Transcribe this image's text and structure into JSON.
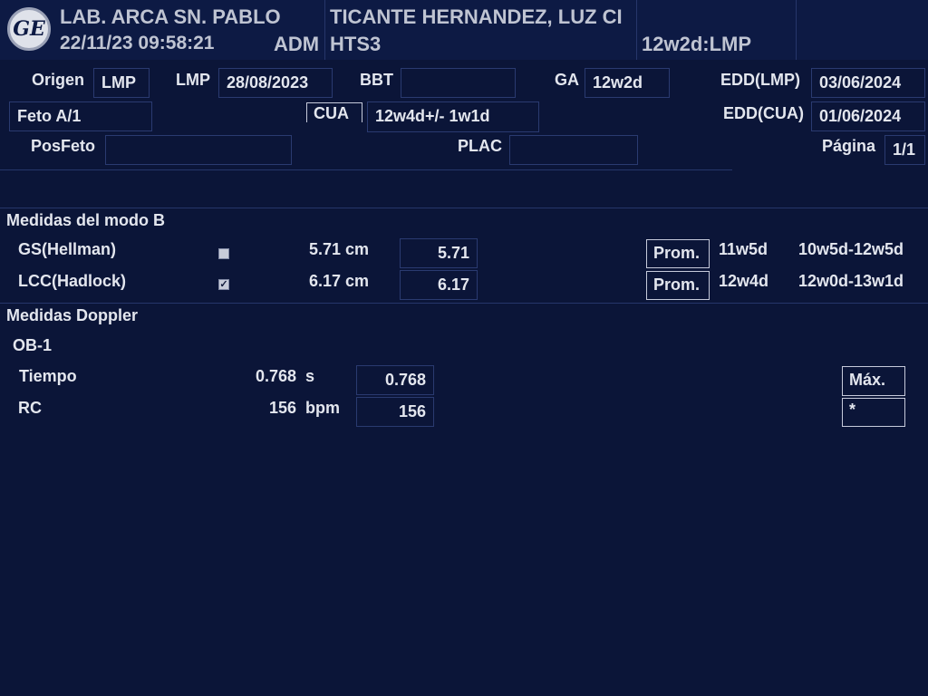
{
  "header": {
    "logo_text": "GE",
    "institution": "LAB. ARCA SN. PABLO",
    "datetime": "22/11/23 09:58:21",
    "operator": "ADM",
    "patient": "TICANTE HERNANDEZ, LUZ CI",
    "probe": "HTS3",
    "ga": "12w2d:LMP"
  },
  "patient_info": {
    "origen_label": "Origen",
    "origen_value": "LMP",
    "lmp_label": "LMP",
    "lmp_value": "28/08/2023",
    "bbt_label": "BBT",
    "bbt_value": "",
    "ga_label": "GA",
    "ga_value": "12w2d",
    "edd_lmp_label": "EDD(LMP)",
    "edd_lmp_value": "03/06/2024",
    "feto_value": "Feto A/1",
    "cua_label": "CUA",
    "cua_value": "12w4d+/- 1w1d",
    "edd_cua_label": "EDD(CUA)",
    "edd_cua_value": "01/06/2024",
    "posfeto_label": "PosFeto",
    "posfeto_value": "",
    "plac_label": "PLAC",
    "plac_value": "",
    "pagina_label": "Página",
    "pagina_value": "1/1"
  },
  "bmode": {
    "title": "Medidas del modo B",
    "rows": [
      {
        "name": "GS(Hellman)",
        "checked": false,
        "value": "5.71 cm",
        "box": "5.71",
        "button": "Prom.",
        "ga": "11w5d",
        "range": "10w5d-12w5d"
      },
      {
        "name": "LCC(Hadlock)",
        "checked": true,
        "check_mark": "✓",
        "value": "6.17 cm",
        "box": "6.17",
        "button": "Prom.",
        "ga": "12w4d",
        "range": "12w0d-13w1d"
      }
    ]
  },
  "doppler": {
    "title": "Medidas Doppler",
    "subtitle": "OB-1",
    "rows": [
      {
        "name": "Tiempo",
        "value": "0.768",
        "unit": "s",
        "box": "0.768"
      },
      {
        "name": "RC",
        "value": "156",
        "unit": "bpm",
        "box": "156"
      }
    ],
    "max_button": "Máx.",
    "max_value": "*"
  }
}
